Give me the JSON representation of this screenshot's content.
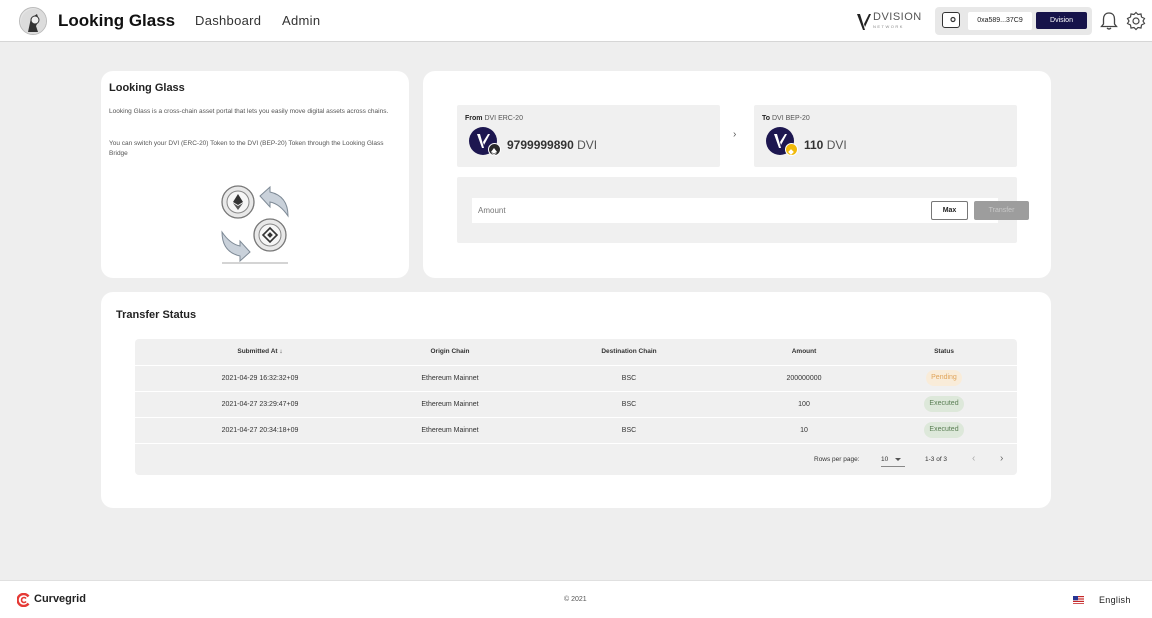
{
  "header": {
    "brand": "Looking Glass",
    "nav": [
      "Dashboard",
      "Admin"
    ],
    "partner_logo": {
      "name": "DVISION",
      "sub": "NETWORK"
    },
    "wallet": {
      "address": "0xa589...37C9",
      "network_button": "Dvision"
    },
    "icons": [
      "bell-icon",
      "gear-icon"
    ]
  },
  "intro": {
    "title": "Looking Glass",
    "paragraph1": "Looking Glass is a cross-chain asset portal that lets you easily move digital assets across chains.",
    "paragraph2": "You can switch your DVI (ERC-20) Token to the DVI (BEP-20) Token through the Looking Glass Bridge"
  },
  "transfer": {
    "from": {
      "prefix": "From",
      "chain": "DVI ERC-20",
      "balance": "9799999890",
      "unit": "DVI"
    },
    "to": {
      "prefix": "To",
      "chain": "DVI BEP-20",
      "balance": "110",
      "unit": "DVI"
    },
    "arrow": "›",
    "amount_placeholder": "Amount",
    "max_label": "Max",
    "transfer_label": "Transfer"
  },
  "status": {
    "title": "Transfer Status",
    "columns": [
      "Submitted At ↓",
      "Origin Chain",
      "Destination Chain",
      "Amount",
      "Status"
    ],
    "rows": [
      {
        "submitted": "2021-04-29 16:32:32+09",
        "origin": "Ethereum Mainnet",
        "dest": "BSC",
        "amount": "200000000",
        "status": "Pending"
      },
      {
        "submitted": "2021-04-27 23:29:47+09",
        "origin": "Ethereum Mainnet",
        "dest": "BSC",
        "amount": "100",
        "status": "Executed"
      },
      {
        "submitted": "2021-04-27 20:34:18+09",
        "origin": "Ethereum Mainnet",
        "dest": "BSC",
        "amount": "10",
        "status": "Executed"
      }
    ],
    "pager": {
      "rows_label": "Rows per page:",
      "rows_value": "10",
      "range": "1-3 of 3",
      "prev": "‹",
      "next": "›"
    }
  },
  "footer": {
    "company": "Curvegrid",
    "copyright": "© 2021",
    "language": "English"
  },
  "colors": {
    "accent_navy": "#16134a",
    "pending": "#e0a45a",
    "executed": "#5b7f55",
    "background": "#eeeeee",
    "curvegrid_red": "#e53935"
  }
}
